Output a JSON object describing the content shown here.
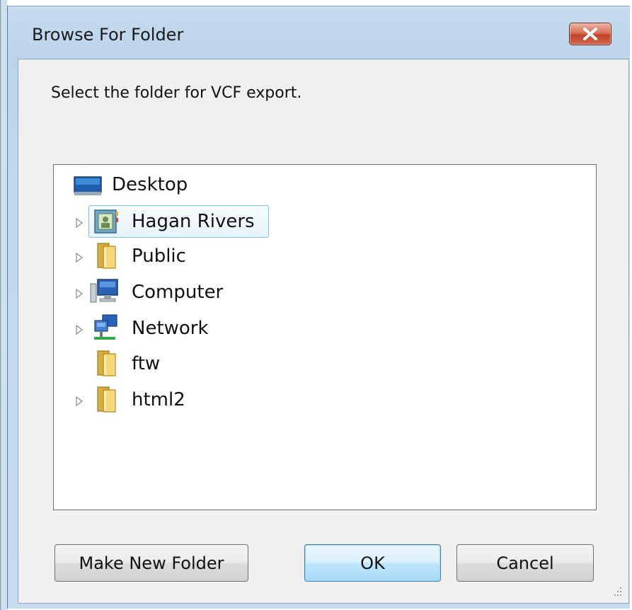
{
  "window": {
    "title": "Browse For Folder"
  },
  "dialog": {
    "instruction": "Select the folder for VCF export."
  },
  "tree": {
    "items": [
      {
        "label": "Desktop",
        "icon": "desktop-icon",
        "expandable": false,
        "selected": false
      },
      {
        "label": "Hagan Rivers",
        "icon": "user-folder-icon",
        "expandable": true,
        "selected": true
      },
      {
        "label": "Public",
        "icon": "folder-icon",
        "expandable": true,
        "selected": false
      },
      {
        "label": "Computer",
        "icon": "computer-icon",
        "expandable": true,
        "selected": false
      },
      {
        "label": "Network",
        "icon": "network-icon",
        "expandable": true,
        "selected": false
      },
      {
        "label": "ftw",
        "icon": "folder-icon",
        "expandable": false,
        "selected": false
      },
      {
        "label": "html2",
        "icon": "folder-icon",
        "expandable": true,
        "selected": false
      }
    ]
  },
  "buttons": {
    "make_new_folder": "Make New Folder",
    "ok": "OK",
    "cancel": "Cancel"
  },
  "colors": {
    "frame": "#c6dbef",
    "close_button": "#c2432a",
    "selection_border": "#7dc3e8",
    "default_button": "#bee6fd"
  }
}
